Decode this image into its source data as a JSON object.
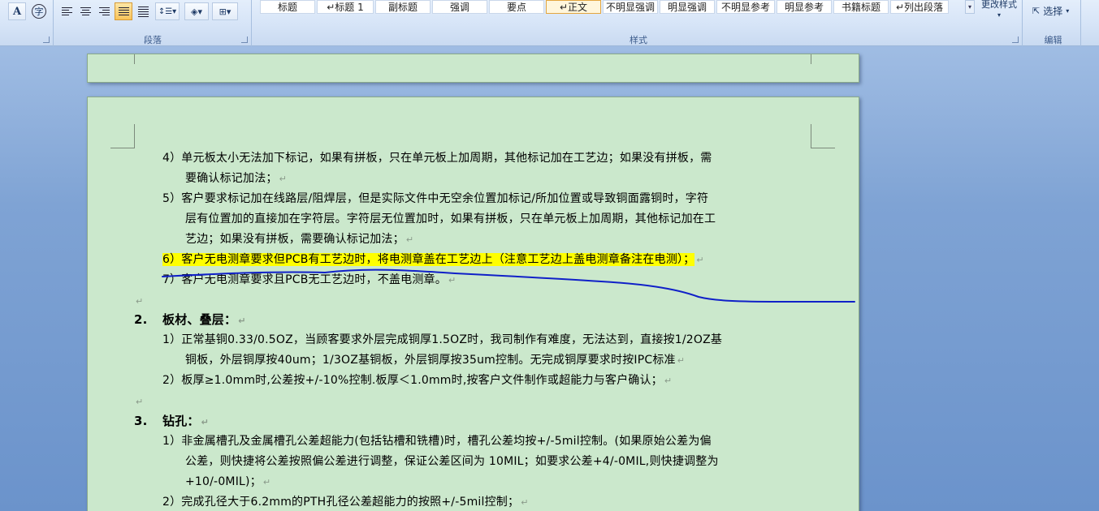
{
  "ribbon": {
    "font_glyphs": {
      "char_border": "A",
      "enclosed_char": "字"
    },
    "paragraph": {
      "label": "段落",
      "buttons": [
        {
          "name": "align-left",
          "active": false
        },
        {
          "name": "align-center",
          "active": false
        },
        {
          "name": "align-right",
          "active": false
        },
        {
          "name": "justify",
          "active": true
        },
        {
          "name": "distributed",
          "active": false
        }
      ]
    },
    "styles": {
      "label": "样式",
      "items": [
        {
          "text": "标题",
          "current": false
        },
        {
          "text": "↵标题 1",
          "current": false
        },
        {
          "text": "副标题",
          "current": false
        },
        {
          "text": "强调",
          "current": false
        },
        {
          "text": "要点",
          "current": false
        },
        {
          "text": "↵正文",
          "current": true
        },
        {
          "text": "不明显强调",
          "current": false
        },
        {
          "text": "明显强调",
          "current": false
        },
        {
          "text": "不明显参考",
          "current": false
        },
        {
          "text": "明显参考",
          "current": false
        },
        {
          "text": "书籍标题",
          "current": false
        },
        {
          "text": "↵列出段落",
          "current": false
        }
      ],
      "change_styles": "更改样式"
    },
    "editing": {
      "label": "编辑",
      "select": "选择"
    }
  },
  "document": {
    "paragraph_mark": "↵",
    "lines": [
      {
        "text": "4）单元板太小无法加下标记，如果有拼板，只在单元板上加周期，其他标记加在工艺边；如果没有拼板，需",
        "mark": false
      },
      {
        "text": "要确认标记加法；",
        "mark": true
      },
      {
        "text": "5）客户要求标记加在线路层/阻焊层，但是实际文件中无空余位置加标记/所加位置或导致铜面露铜时，字符",
        "mark": false
      },
      {
        "text": "层有位置加的直接加在字符层。字符层无位置加时，如果有拼板，只在单元板上加周期，其他标记加在工",
        "mark": false
      },
      {
        "text": "艺边；如果没有拼板，需要确认标记加法；",
        "mark": true
      },
      {
        "text": "6）客户无电测章要求但PCB有工艺边时，将电测章盖在工艺边上（注意工艺边上盖电测章备注在电测）；",
        "mark": true,
        "highlight": true
      },
      {
        "text": "7）客户无电测章要求且PCB无工艺边时，不盖电测章。",
        "mark": true
      },
      {
        "text": "",
        "mark": true
      },
      {
        "text": "2.",
        "mark": false,
        "heading": true
      },
      {
        "text": "板材、叠层：",
        "mark": true,
        "heading": true
      },
      {
        "text": "1）正常基铜0.33/0.5OZ，当顾客要求外层完成铜厚1.5OZ时，我司制作有难度，无法达到，直接按1/2OZ基",
        "mark": false
      },
      {
        "text": "铜板，外层铜厚按40um；1/3OZ基铜板，外层铜厚按35um控制。无完成铜厚要求时按IPC标准",
        "mark": true
      },
      {
        "text": "2）板厚≥1.0mm时,公差按+/-10%控制.板厚＜1.0mm时,按客户文件制作或超能力与客户确认；",
        "mark": true
      },
      {
        "text": "",
        "mark": true
      },
      {
        "text": "3.",
        "mark": false,
        "heading": true
      },
      {
        "text": "钻孔：",
        "mark": true,
        "heading": true
      },
      {
        "text": "1）非金属槽孔及金属槽孔公差超能力(包括钻槽和铣槽)时，槽孔公差均按+/-5mil控制。(如果原始公差为偏",
        "mark": false
      },
      {
        "text": "公差，则快捷将公差按照偏公差进行调整，保证公差区间为 10MIL；如要求公差+4/-0MIL,则快捷调整为",
        "mark": false
      },
      {
        "text": "+10/-0MIL)；",
        "mark": true
      },
      {
        "text": "2）完成孔径大于6.2mm的PTH孔径公差超能力的按照+/-5mil控制；",
        "mark": true
      }
    ]
  },
  "colors": {
    "page_bg": "#cbe8cc",
    "highlight": "#ffff00",
    "ink_stroke": "#1020c8"
  }
}
